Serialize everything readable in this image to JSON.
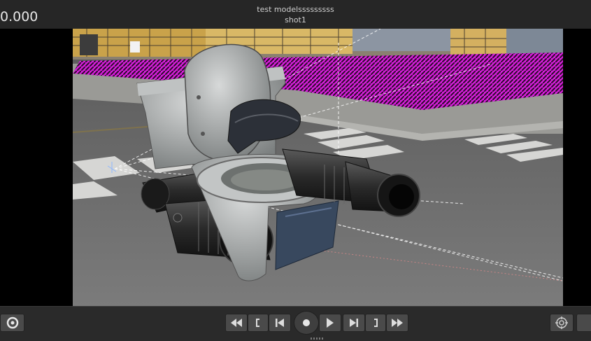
{
  "header": {
    "timecode": "0.000",
    "session_name": "test modelsssssssss",
    "shot_name": "shot1"
  },
  "viewport": {
    "scene": "3d-viewport",
    "colors": {
      "missing_texture": "#d020d8",
      "asphalt": "#6e6e6e",
      "crosswalk": "#d8d8d8",
      "sky_building": "#c8a040"
    }
  },
  "transport": {
    "buttons": [
      {
        "name": "rewind-button",
        "icon": "rewind-icon"
      },
      {
        "name": "mark-in-button",
        "icon": "mark-in-bracket-icon"
      },
      {
        "name": "prev-frame-button",
        "icon": "step-back-icon"
      },
      {
        "name": "record-button",
        "icon": "record-icon"
      },
      {
        "name": "play-button",
        "icon": "play-icon"
      },
      {
        "name": "next-frame-button",
        "icon": "step-forward-icon"
      },
      {
        "name": "mark-out-button",
        "icon": "mark-out-bracket-icon"
      },
      {
        "name": "fast-forward-button",
        "icon": "fast-forward-icon"
      }
    ]
  }
}
